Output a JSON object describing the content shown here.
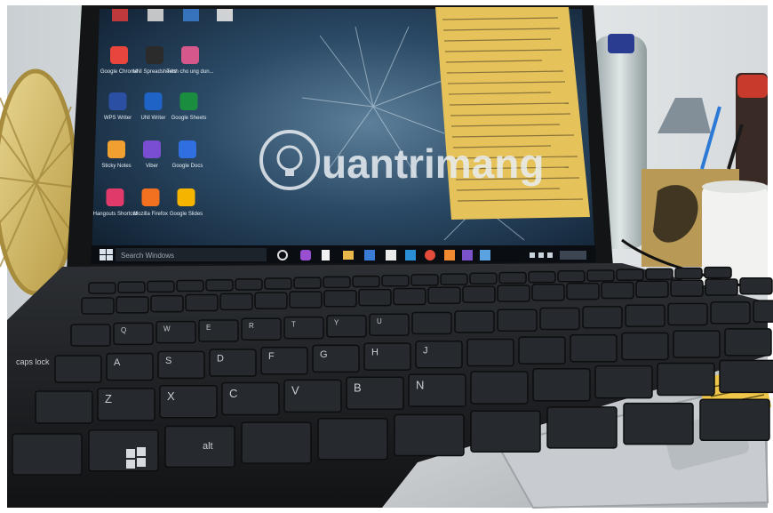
{
  "photo": {
    "scene": "laptop-on-desk",
    "watermark": {
      "brand": "uantrimang",
      "logo_letter": "Q",
      "color": "#e9eef2"
    },
    "taskbar": {
      "search_placeholder": "Search Windows"
    },
    "desktop_icons": [
      {
        "label": "Google Chrome",
        "icon": "chrome-icon",
        "color": "#e8453c"
      },
      {
        "label": "UNI Spreadsheets",
        "icon": "spreadsheet-icon",
        "color": "#2b2b2b"
      },
      {
        "label": "Trinh cho ung dun...",
        "icon": "app-grid-icon",
        "color": "#d4588a"
      },
      {
        "label": "WPS Writer",
        "icon": "wps-icon",
        "color": "#2a4fa3"
      },
      {
        "label": "UNI Writer",
        "icon": "writer-icon",
        "color": "#1f63c7"
      },
      {
        "label": "Google Sheets",
        "icon": "sheets-icon",
        "color": "#1a8d3f"
      },
      {
        "label": "Sticky Notes",
        "icon": "sticky-notes-icon",
        "color": "#f0a030"
      },
      {
        "label": "Viber",
        "icon": "viber-icon",
        "color": "#7a4ed0"
      },
      {
        "label": "Google Docs",
        "icon": "docs-icon",
        "color": "#2f6fdf"
      },
      {
        "label": "Hangouts Shortcut",
        "icon": "hangouts-icon",
        "color": "#e03a6a"
      },
      {
        "label": "Mozilla Firefox",
        "icon": "firefox-icon",
        "color": "#f27121"
      },
      {
        "label": "Google Slides",
        "icon": "slides-icon",
        "color": "#f4b400"
      }
    ],
    "keyboard": {
      "keys": [
        "Q",
        "W",
        "E",
        "R",
        "T",
        "Y",
        "U",
        "A",
        "S",
        "D",
        "F",
        "G",
        "H",
        "J",
        "Z",
        "X",
        "C",
        "V",
        "B",
        "N"
      ],
      "special_keys": [
        "caps lock",
        "alt"
      ]
    },
    "colors": {
      "screen": "#1c2f44",
      "keyboard": "#1b1d20",
      "sticky_note": "#e6c25a",
      "fan": "#d9c27a"
    }
  }
}
